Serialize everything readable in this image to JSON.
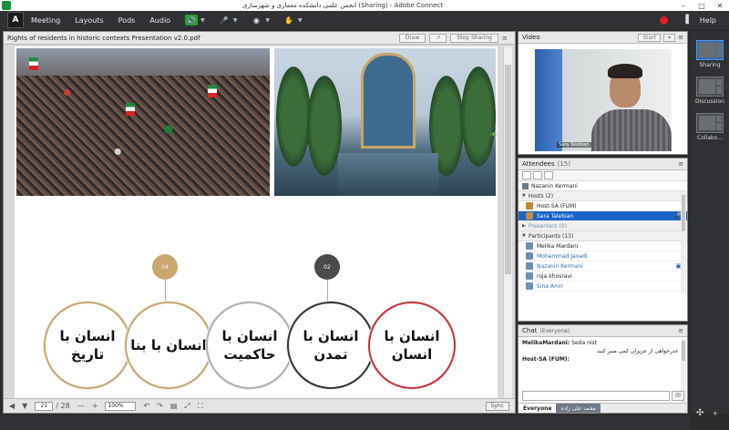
{
  "window": {
    "title": "انجمن علمی دانشکده معماری و شهرسازی (Sharing) - Adobe Connect",
    "minimize": "–",
    "maximize": "□",
    "close": "✕"
  },
  "menubar": {
    "logo": "Adobe",
    "items": [
      "Meeting",
      "Layouts",
      "Pods",
      "Audio"
    ],
    "help": "Help",
    "record_color": "#e02020"
  },
  "share_pod": {
    "title": "Rights of residents in historic contexts Presentation v2.0.pdf",
    "draw_label": "Draw",
    "stop_sharing_label": "Stop Sharing",
    "slide": {
      "badges": [
        {
          "label": "04",
          "color": "#c9a76e"
        },
        {
          "label": "02",
          "color": "#4a4a4a"
        }
      ],
      "circles": [
        {
          "text": "انسان با تاریخ",
          "ring": "#c9a76e"
        },
        {
          "text": "انسان با بنا",
          "ring": "#c9a76e"
        },
        {
          "text": "انسان با حاکمیت",
          "ring": "#b0b0b0"
        },
        {
          "text": "انسان با تمدن",
          "ring": "#333333"
        },
        {
          "text": "انسان با انسان",
          "ring": "#c2343c"
        }
      ]
    },
    "footer": {
      "current_page": "21",
      "total_pages": "/ 28",
      "zoom": "100%",
      "sync_label": "Sync"
    }
  },
  "video_pod": {
    "title": "Video",
    "start_label": "Start",
    "speaker_name": "Sara Talebian"
  },
  "attendees_pod": {
    "title": "Attendees",
    "count": "(15)",
    "me": "Nazanin Kermani",
    "groups": {
      "hosts": "Hosts (2)",
      "presenters": "Presenters (0)",
      "participants": "Participants (13)"
    },
    "hosts": [
      "Host-SA (FUM)",
      "Sara Talebian"
    ],
    "participants": [
      "Melika Mardani",
      "Mohammad Javadi",
      "Nazanin Kermani",
      "roja khosravi",
      "Sina Amir"
    ]
  },
  "chat_pod": {
    "title": "Chat",
    "scope": "(Everyone)",
    "messages": [
      {
        "name": "MelikaMardani:",
        "text": "Seda nist"
      },
      {
        "name": "Host-SA (FUM):",
        "text": "با عذرخواهی از عزیزان کمی صبر کنید"
      }
    ],
    "tabs": [
      "Everyone",
      "محمد علی زاده"
    ]
  },
  "layouts": {
    "items": [
      "Sharing",
      "Discussion",
      "Collabo..."
    ]
  }
}
